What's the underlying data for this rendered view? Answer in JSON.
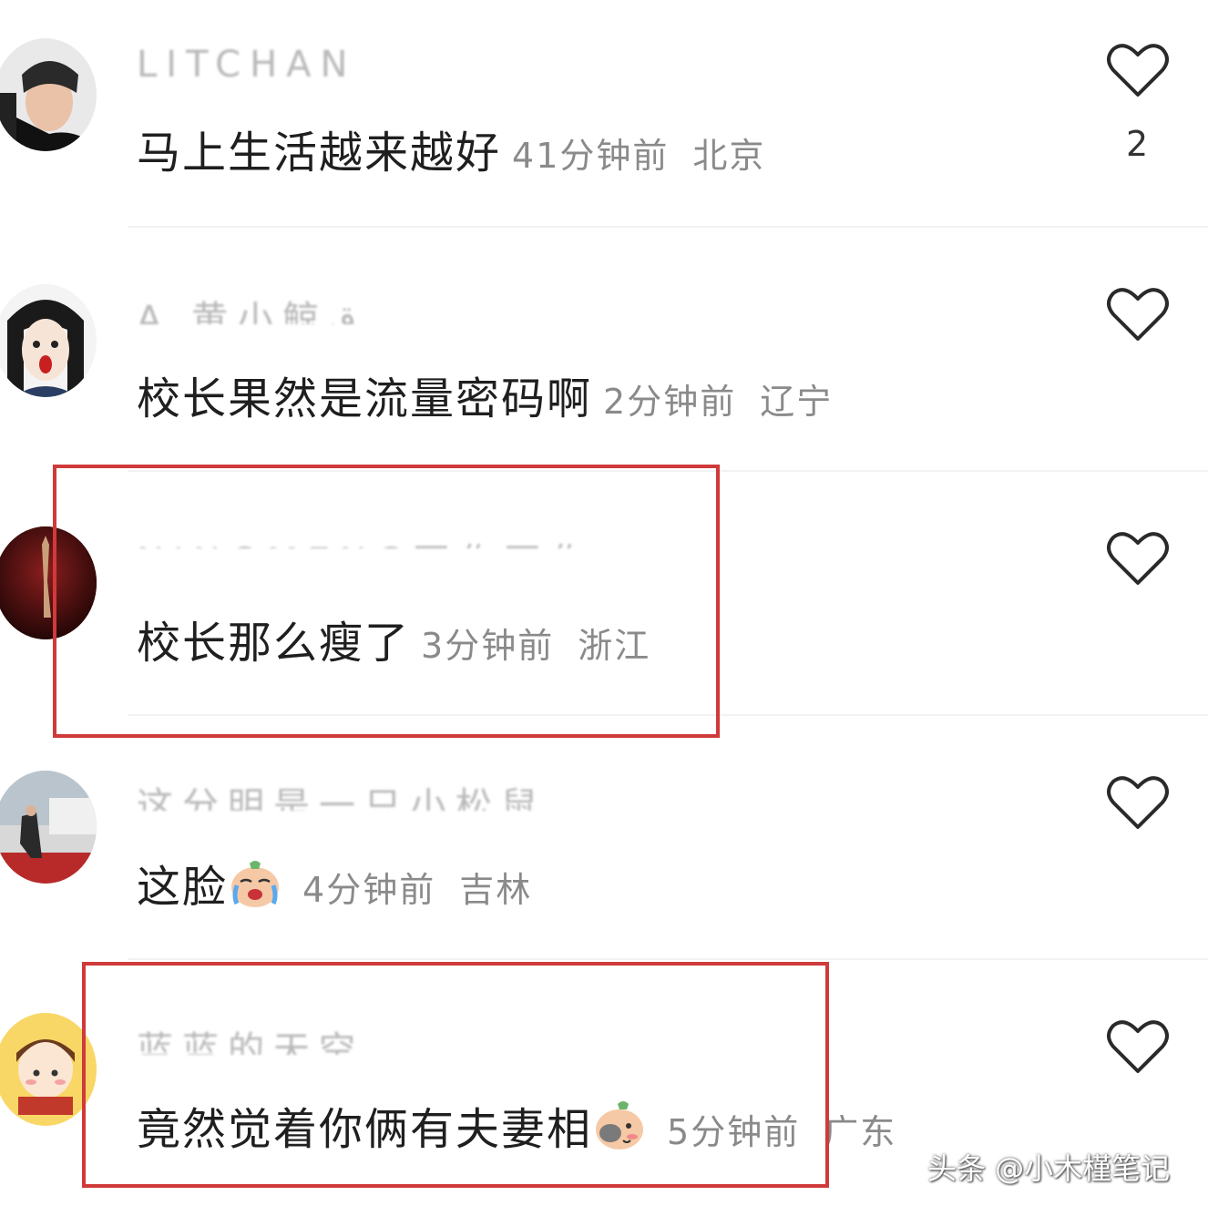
{
  "comments": [
    {
      "username": "LITCHAN",
      "text": "马上生活越来越好",
      "time": "41分钟前",
      "location": "北京",
      "likes": "2",
      "highlighted": false
    },
    {
      "username": "A   黄小鲸ق",
      "text": "校长果然是流量密码啊",
      "time": "2分钟前",
      "location": "辽宁",
      "likes": "",
      "highlighted": false
    },
    {
      "username": "NINGMENG不作不作",
      "text": "校长那么瘦了",
      "time": "3分钟前",
      "location": "浙江",
      "likes": "",
      "highlighted": true
    },
    {
      "username": "这分明是一只小松鼠",
      "text": "这脸",
      "emoji": "crying-face-emoji",
      "time": "4分钟前",
      "location": "吉林",
      "likes": "",
      "highlighted": false
    },
    {
      "username": "蓝蓝的天空",
      "text": "竟然觉着你俩有夫妻相",
      "emoji": "shy-face-emoji",
      "time": "5分钟前",
      "location": "广东",
      "likes": "",
      "highlighted": true
    }
  ],
  "watermark": "头条 @小木槿笔记",
  "colors": {
    "highlight_border": "#d03a3a",
    "text": "#1f1f1f",
    "meta": "#8a8a8a"
  }
}
